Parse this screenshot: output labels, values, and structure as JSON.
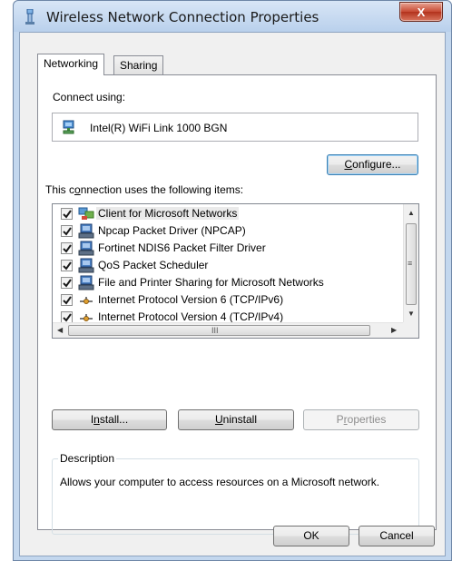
{
  "window": {
    "title": "Wireless Network Connection Properties",
    "close_symbol": "X"
  },
  "tabs": [
    {
      "label": "Networking",
      "active": true
    },
    {
      "label": "Sharing",
      "active": false
    }
  ],
  "connect_using": {
    "label_pre": "Connect using:",
    "adapter_name": "Intel(R) WiFi Link 1000 BGN",
    "adapter_icon": "network-adapter-icon"
  },
  "configure_button": {
    "pre": "",
    "accel": "C",
    "post": "onfigure..."
  },
  "items_label": {
    "pre": "This c",
    "accel": "o",
    "post": "nnection uses the following items:"
  },
  "items": [
    {
      "label": "Client for Microsoft Networks",
      "checked": true,
      "icon": "network-client-icon",
      "selected": true
    },
    {
      "label": "Npcap Packet Driver (NPCAP)",
      "checked": true,
      "icon": "network-service-icon",
      "selected": false
    },
    {
      "label": "Fortinet NDIS6 Packet Filter Driver",
      "checked": true,
      "icon": "network-service-icon",
      "selected": false
    },
    {
      "label": "QoS Packet Scheduler",
      "checked": true,
      "icon": "network-service-icon",
      "selected": false
    },
    {
      "label": "File and Printer Sharing for Microsoft Networks",
      "checked": true,
      "icon": "network-service-icon",
      "selected": false
    },
    {
      "label": "Internet Protocol Version 6 (TCP/IPv6)",
      "checked": true,
      "icon": "network-protocol-icon",
      "selected": false
    },
    {
      "label": "Internet Protocol Version 4 (TCP/IPv4)",
      "checked": true,
      "icon": "network-protocol-icon",
      "selected": false
    }
  ],
  "scrollbar": {
    "h_grip": "III",
    "v_grip": "≡"
  },
  "buttons": {
    "install": {
      "pre": "I",
      "accel": "n",
      "post": "stall..."
    },
    "uninstall": {
      "pre": "",
      "accel": "U",
      "post": "ninstall"
    },
    "properties": {
      "pre": "P",
      "accel": "r",
      "post": "operties"
    }
  },
  "description": {
    "legend": "Description",
    "text": "Allows your computer to access resources on a Microsoft network."
  },
  "footer": {
    "ok_label": "OK",
    "cancel_label": "Cancel"
  },
  "colors": {
    "accent": "#3c7fb1",
    "titlebar": "#c3d7ee",
    "close": "#c74a33"
  }
}
